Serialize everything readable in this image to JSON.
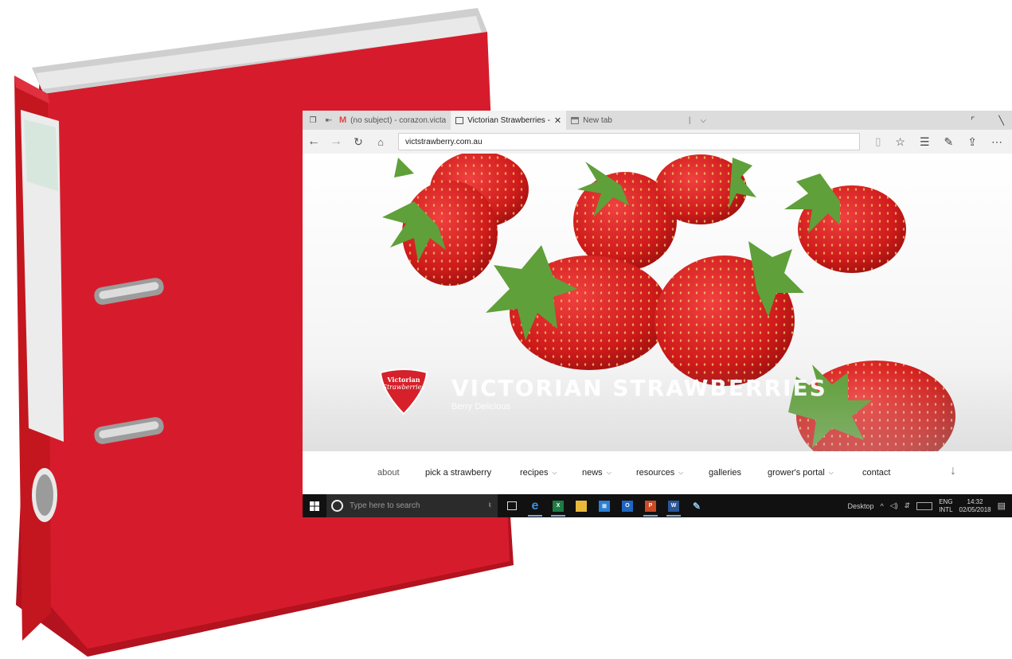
{
  "browser": {
    "tabs": [
      {
        "title": "(no subject) - corazon.victar",
        "favicon": "gmail-icon",
        "active": false
      },
      {
        "title": "Victorian Strawberries - ",
        "favicon": "page-icon",
        "active": true
      },
      {
        "title": "New tab",
        "favicon": "newtab-icon",
        "active": false
      }
    ],
    "close_glyph": "✕",
    "url": "victstrawberry.com.au"
  },
  "site": {
    "logo_line1": "Victorian",
    "logo_line2": "Strawberries",
    "title": "VICTORIAN STRAWBERRIES",
    "tagline": "Berry Delicious"
  },
  "menu": {
    "items": [
      {
        "label": "about",
        "dropdown": false
      },
      {
        "label": "pick a strawberry",
        "dropdown": false
      },
      {
        "label": "recipes",
        "dropdown": true
      },
      {
        "label": "news",
        "dropdown": true
      },
      {
        "label": "resources",
        "dropdown": true
      },
      {
        "label": "galleries",
        "dropdown": false
      },
      {
        "label": "grower's portal",
        "dropdown": true
      },
      {
        "label": "contact",
        "dropdown": false
      }
    ],
    "scroll_glyph": "↓"
  },
  "taskbar": {
    "search_placeholder": "Type here to search",
    "desktop_label": "Desktop",
    "lang_line1": "ENG",
    "lang_line2": "INTL",
    "time": "14:32",
    "date": "02/05/2018"
  },
  "colors": {
    "binder_red": "#d61c2c",
    "strawberry_red": "#d81e1e",
    "leaf_green": "#5fa03a",
    "taskbar": "#111111"
  }
}
